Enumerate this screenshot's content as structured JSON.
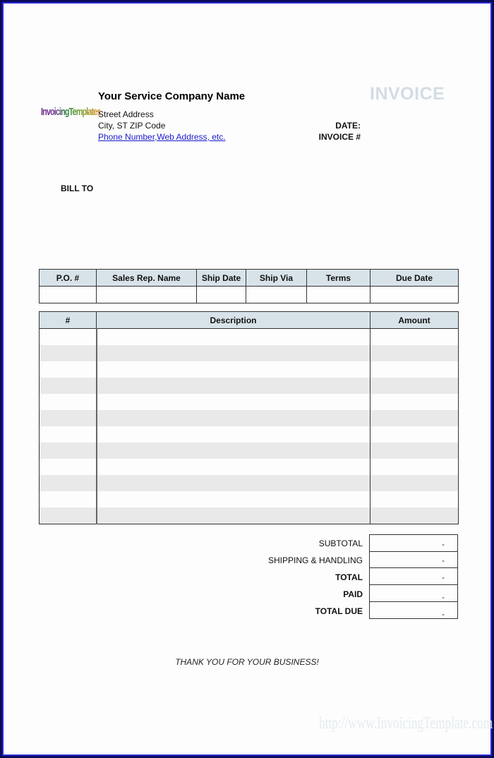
{
  "logo": {
    "text": "InvoicingTemplates",
    "colors": [
      "#6a2a8a",
      "#2e8a3a",
      "#e08a1a"
    ]
  },
  "company": {
    "name": "Your Service Company Name",
    "street": "Street Address",
    "city": "City, ST  ZIP Code",
    "contact_link": "Phone Number,Web Address, etc."
  },
  "document": {
    "title": "INVOICE",
    "title_color": "#d2dde3",
    "date_label": "DATE:",
    "date_value": "",
    "invoice_number_label": "INVOICE #",
    "invoice_number_value": ""
  },
  "bill_to": {
    "label": "BILL TO",
    "value": ""
  },
  "order_table": {
    "header_color": "#d8e3e9",
    "columns": [
      "P.O. #",
      "Sales Rep. Name",
      "Ship Date",
      "Ship Via",
      "Terms",
      "Due Date"
    ],
    "values": [
      "",
      "",
      "",
      "",
      "",
      ""
    ]
  },
  "items_table": {
    "columns": [
      "#",
      "Description",
      "Amount"
    ],
    "alt_row_color": "#e9e9e9",
    "rows": [
      {
        "num": "",
        "description": "",
        "amount": ""
      },
      {
        "num": "",
        "description": "",
        "amount": ""
      },
      {
        "num": "",
        "description": "",
        "amount": ""
      },
      {
        "num": "",
        "description": "",
        "amount": ""
      },
      {
        "num": "",
        "description": "",
        "amount": ""
      },
      {
        "num": "",
        "description": "",
        "amount": ""
      },
      {
        "num": "",
        "description": "",
        "amount": ""
      },
      {
        "num": "",
        "description": "",
        "amount": ""
      },
      {
        "num": "",
        "description": "",
        "amount": ""
      },
      {
        "num": "",
        "description": "",
        "amount": ""
      },
      {
        "num": "",
        "description": "",
        "amount": ""
      },
      {
        "num": "",
        "description": "",
        "amount": ""
      }
    ]
  },
  "totals": [
    {
      "label": "SUBTOTAL",
      "value": "-",
      "bold": false
    },
    {
      "label": "SHIPPING & HANDLING",
      "value": "-",
      "bold": false
    },
    {
      "label": "TOTAL",
      "value": "-",
      "bold": true
    },
    {
      "label": "PAID",
      "value": "-",
      "bold": true
    },
    {
      "label": "TOTAL DUE",
      "value": "-",
      "bold": true
    }
  ],
  "footer": {
    "thanks": "THANK YOU FOR YOUR BUSINESS!",
    "watermark": "http://www.InvoicingTemplate.com"
  },
  "frame": {
    "outer_color": "#0a0a5a",
    "inner_color": "#2a2ad0"
  }
}
